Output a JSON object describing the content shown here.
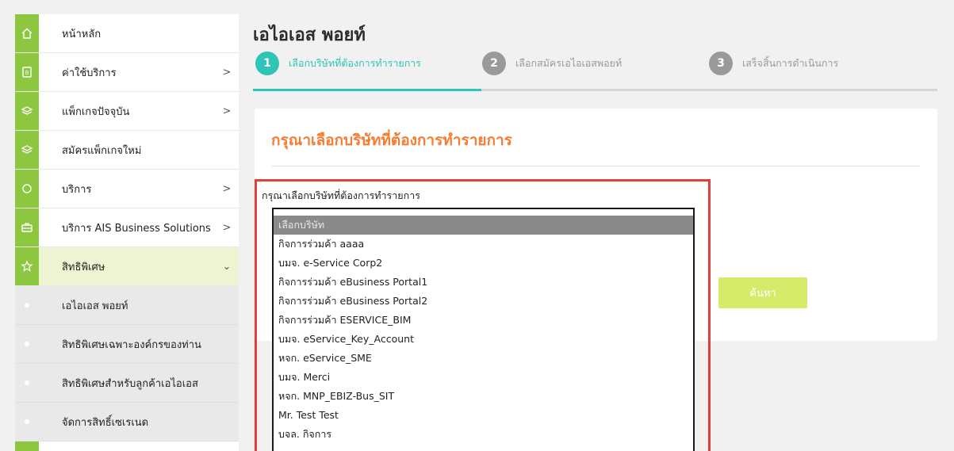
{
  "sidebar": {
    "items": [
      {
        "label": "หน้าหลัก",
        "icon": "home-icon",
        "chevron": ""
      },
      {
        "label": "ค่าใช้บริการ",
        "icon": "bill-icon",
        "chevron": ">"
      },
      {
        "label": "แพ็กเกจปัจจุบัน",
        "icon": "layers-icon",
        "chevron": ">"
      },
      {
        "label": "สมัครแพ็กเกจใหม่",
        "icon": "layers-icon",
        "chevron": ""
      },
      {
        "label": "บริการ",
        "icon": "circle-icon",
        "chevron": ">"
      },
      {
        "label": "บริการ AIS Business Solutions",
        "icon": "briefcase-icon",
        "chevron": ">"
      },
      {
        "label": "สิทธิพิเศษ",
        "icon": "star-icon",
        "chevron": "⌄"
      },
      {
        "label": "เอไอเอส พอยท์",
        "icon": "dot-icon",
        "chevron": ""
      },
      {
        "label": "สิทธิพิเศษเฉพาะองค์กรของท่าน",
        "icon": "dot-icon",
        "chevron": ""
      },
      {
        "label": "สิทธิพิเศษสำหรับลูกค้าเอไอเอส",
        "icon": "dot-icon",
        "chevron": ""
      },
      {
        "label": "จัดการสิทธิ์เซเรเนด",
        "icon": "dot-icon",
        "chevron": ""
      }
    ]
  },
  "header": {
    "title": "เอไอเอส พอยท์"
  },
  "steps": [
    {
      "num": "1",
      "label": "เลือกบริษัทที่ต้องการทำรายการ"
    },
    {
      "num": "2",
      "label": "เลือกสมัครเอไอเอสพอยท์"
    },
    {
      "num": "3",
      "label": "เสร็จสิ้นการดำเนินการ"
    }
  ],
  "card": {
    "title": "กรุณาเลือกบริษัทที่ต้องการทำรายการ",
    "field_label": "กรุณาเลือกบริษัทที่ต้องการทำรายการ",
    "search_label": "ค้นหา"
  },
  "dropdown": {
    "options": [
      "เลือกบริษัท",
      "กิจการร่วมค้า aaaa",
      "บมจ. e-Service Corp2",
      "กิจการร่วมค้า eBusiness Portal1",
      "กิจการร่วมค้า eBusiness Portal2",
      "กิจการร่วมค้า ESERVICE_BIM",
      "บมจ. eService_Key_Account",
      "หจก. eService_SME",
      "บมจ. Merci",
      "หจก. MNP_EBIZ-Bus_SIT",
      "Mr. Test Test",
      "บจล. กิจการ"
    ],
    "selected_index": 0
  },
  "colors": {
    "accent_green": "#8dc63f",
    "step_teal": "#2ec4b6",
    "title_orange": "#f57c32",
    "highlight_red": "#e0403a",
    "button_lime": "#d7eb6a"
  }
}
